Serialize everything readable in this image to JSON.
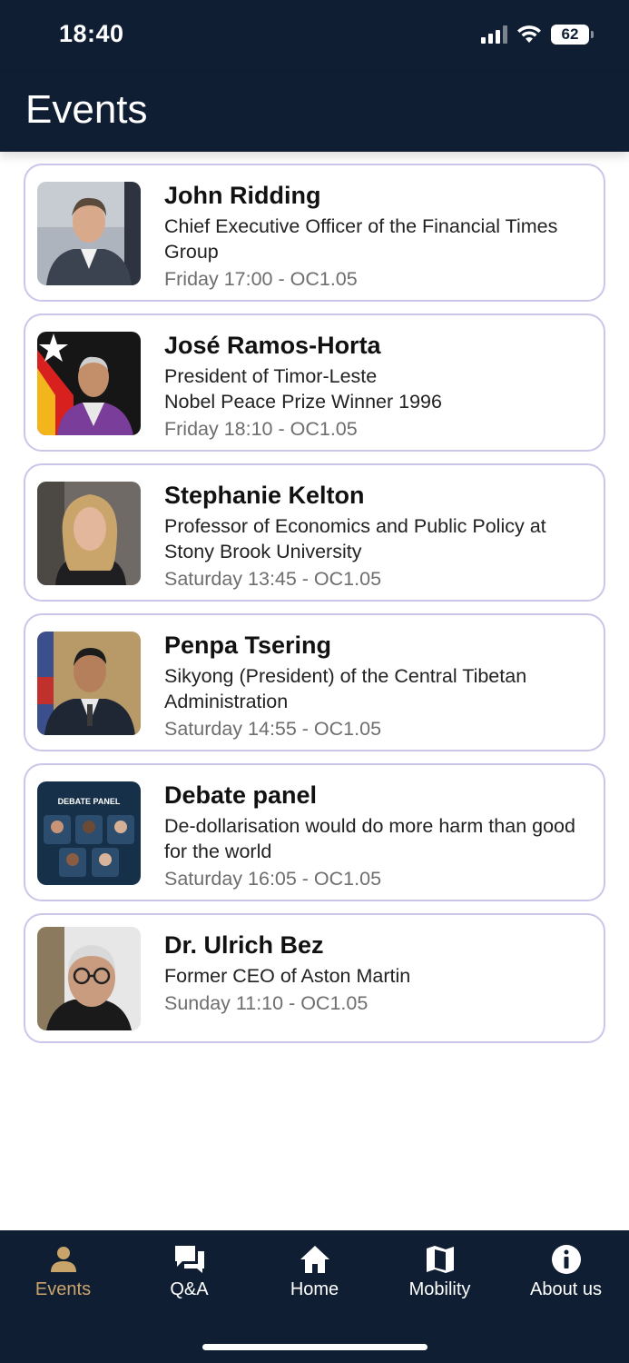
{
  "status": {
    "time": "18:40",
    "battery": "62"
  },
  "header": {
    "title": "Events"
  },
  "events": [
    {
      "name": "John Ridding",
      "description": "Chief Executive Officer of the Financial Times Group",
      "time": "Friday 17:00 - OC1.05"
    },
    {
      "name": "José Ramos-Horta",
      "description": "President of Timor-Leste\nNobel Peace Prize Winner 1996",
      "time": "Friday 18:10 - OC1.05"
    },
    {
      "name": "Stephanie Kelton",
      "description": "Professor of Economics and Public Policy at Stony Brook University",
      "time": "Saturday 13:45 - OC1.05"
    },
    {
      "name": "Penpa Tsering",
      "description": "Sikyong (President) of the Central Tibetan Administration",
      "time": "Saturday 14:55 - OC1.05"
    },
    {
      "name": "Debate panel",
      "description": "De-dollarisation would do more harm than good for the world",
      "time": "Saturday 16:05 - OC1.05",
      "thumb_caption": "DEBATE PANEL"
    },
    {
      "name": "Dr. Ulrich Bez",
      "description": "Former CEO of Aston Martin",
      "time": "Sunday 11:10 - OC1.05"
    }
  ],
  "tabs": [
    {
      "label": "Events",
      "icon": "person-icon",
      "active": true
    },
    {
      "label": "Q&A",
      "icon": "chat-icon",
      "active": false
    },
    {
      "label": "Home",
      "icon": "home-icon",
      "active": false
    },
    {
      "label": "Mobility",
      "icon": "map-icon",
      "active": false
    },
    {
      "label": "About us",
      "icon": "info-icon",
      "active": false
    }
  ],
  "colors": {
    "header_bg": "#0f1e33",
    "card_border": "#c9c6ea",
    "active_tab": "#c9a46a"
  }
}
